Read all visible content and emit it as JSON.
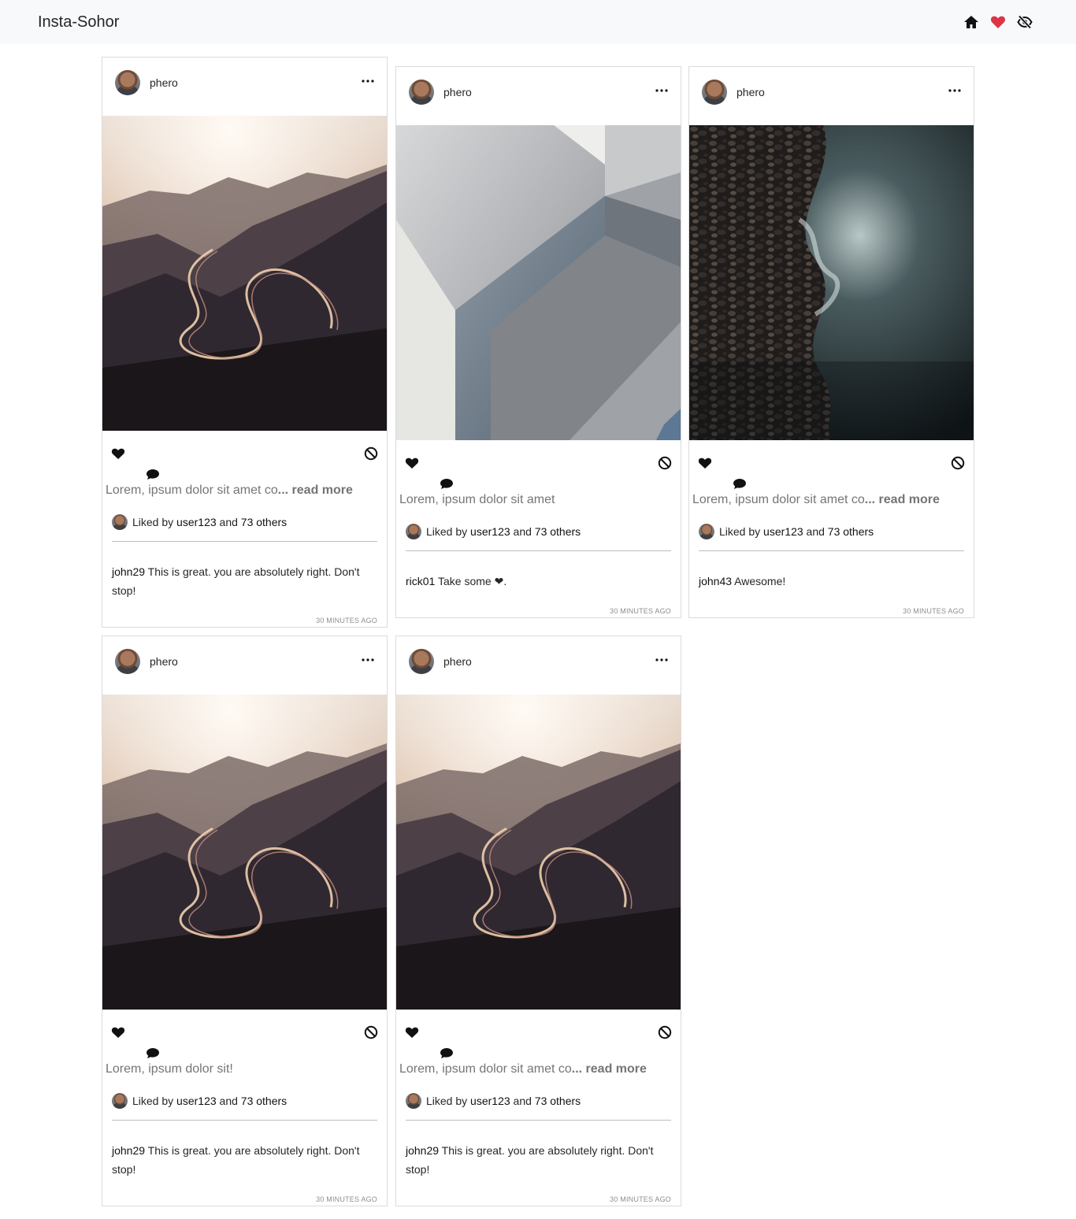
{
  "app": {
    "brand": "Insta-Sohor",
    "nav_icons": [
      "home-icon",
      "heart-icon",
      "eye-slash-icon"
    ],
    "accent_heart": "#dc3545"
  },
  "posts": [
    {
      "username": "phero",
      "image": "mountain-road",
      "caption": "Lorem, ipsum dolor sit amet co",
      "ellipsis": "...",
      "read_more": " read more",
      "liked_prefix": "Liked by ",
      "liked_user": "user123",
      "liked_and": " and ",
      "liked_others": "73 others",
      "comment_user": "john29",
      "comment_text": " This is great. you are absolutely right. Don't stop!",
      "time": "30 MINUTES AGO"
    },
    {
      "username": "phero",
      "image": "abstract-architecture",
      "caption": "Lorem, ipsum dolor sit amet",
      "ellipsis": "",
      "read_more": "",
      "liked_prefix": "Liked by ",
      "liked_user": "user123",
      "liked_and": " and ",
      "liked_others": "73 others",
      "comment_user": "rick01",
      "comment_text": " Take some ❤.",
      "time": "30 MINUTES AGO"
    },
    {
      "username": "phero",
      "image": "pebble-shore",
      "caption": "Lorem, ipsum dolor sit amet co",
      "ellipsis": "...",
      "read_more": " read more",
      "liked_prefix": "Liked by ",
      "liked_user": "user123",
      "liked_and": " and ",
      "liked_others": "73 others",
      "comment_user": "john43",
      "comment_text": " Awesome!",
      "time": "30 MINUTES AGO"
    },
    {
      "username": "phero",
      "image": "mountain-road",
      "caption": "Lorem, ipsum dolor sit!",
      "ellipsis": "",
      "read_more": "",
      "liked_prefix": "Liked by ",
      "liked_user": "user123",
      "liked_and": " and ",
      "liked_others": "73 others",
      "comment_user": "john29",
      "comment_text": " This is great. you are absolutely right. Don't stop!",
      "time": "30 MINUTES AGO"
    },
    {
      "username": "phero",
      "image": "mountain-road",
      "caption": "Lorem, ipsum dolor sit amet co",
      "ellipsis": "...",
      "read_more": " read more",
      "liked_prefix": "Liked by ",
      "liked_user": "user123",
      "liked_and": " and ",
      "liked_others": "73 others",
      "comment_user": "john29",
      "comment_text": " This is great. you are absolutely right. Don't stop!",
      "time": "30 MINUTES AGO"
    }
  ]
}
